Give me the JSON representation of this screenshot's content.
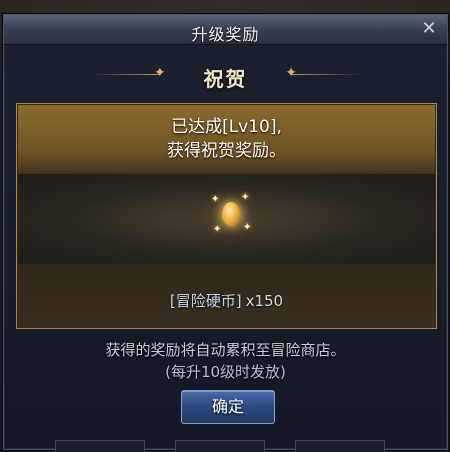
{
  "dialog": {
    "title": "升级奖励",
    "close_symbol": "✕",
    "heading": "祝贺"
  },
  "reward": {
    "achieve_line1": "已达成[Lv10],",
    "achieve_line2": "获得祝贺奖励。",
    "item_icon": "coin-icon",
    "item_name": "[冒险硬币]",
    "item_qty": "x150"
  },
  "info": {
    "line1": "获得的奖励将自动累积至冒险商店。",
    "line2": "(每升10级时发放)"
  },
  "buttons": {
    "confirm": "确定"
  },
  "colors": {
    "title_bar": "#3a4256",
    "gold_panel": "#8a6a2e",
    "confirm_button": "#2e4a82",
    "item_name_text": "#c8d6ea",
    "heading_text": "#f3e6c4"
  }
}
